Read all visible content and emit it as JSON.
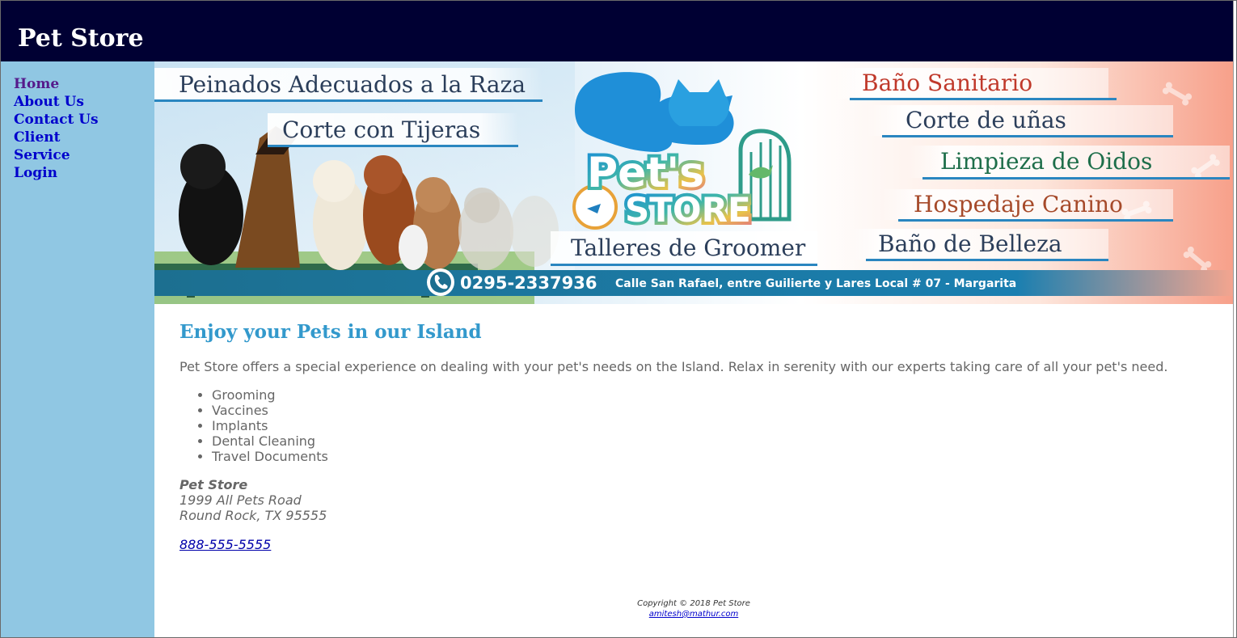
{
  "site": {
    "title": "Pet Store"
  },
  "nav": [
    {
      "label": "Home"
    },
    {
      "label": "About Us"
    },
    {
      "label": "Contact Us"
    },
    {
      "label": "Client"
    },
    {
      "label": "Service"
    },
    {
      "label": "Login"
    }
  ],
  "hero": {
    "left_banners": [
      "Peinados Adecuados a la Raza",
      "Corte con Tijeras",
      "Talleres de Groomer"
    ],
    "right_banners": [
      "Baño Sanitario",
      "Corte de uñas",
      "Limpieza de Oidos",
      "Hospedaje Canino",
      "Baño de Belleza"
    ],
    "logo_top": "Pet's",
    "logo_bottom": "STORE",
    "phone": "0295-2337936",
    "address": "Calle San Rafael, entre Guilierte y Lares Local # 07 - Margarita"
  },
  "main": {
    "heading": "Enjoy your Pets in our Island",
    "intro": "Pet Store offers a special experience on dealing with your pet's needs on the Island. Relax in serenity with our experts taking care of all your pet's need.",
    "services": [
      "Grooming",
      "Vaccines",
      "Implants",
      "Dental Cleaning",
      "Travel Documents"
    ],
    "address": {
      "name": "Pet Store",
      "street": "1999 All Pets Road",
      "city": "Round Rock, TX 95555"
    },
    "phone": "888-555-5555"
  },
  "footer": {
    "copyright": "Copyright © 2018 Pet Store",
    "email": "amitesh@mathur.com"
  },
  "colors": {
    "header_bg": "#000033",
    "sidebar_bg": "#90c7e3",
    "heading": "#3399cc",
    "link": "#0000cc",
    "visited_link": "#551a8b",
    "body_text": "#666666"
  }
}
